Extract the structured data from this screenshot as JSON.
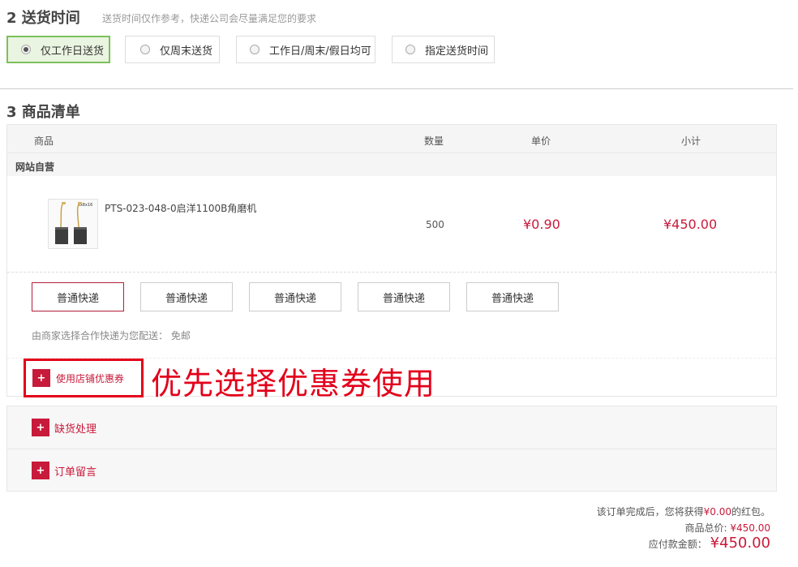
{
  "delivery": {
    "title": "2 送货时间",
    "hint": "送货时间仅作参考，快递公司会尽量满足您的要求",
    "options": [
      "仅工作日送货",
      "仅周末送货",
      "工作日/周末/假日均可",
      "指定送货时间"
    ],
    "selected_index": 0
  },
  "goods": {
    "title": "3 商品清单",
    "columns": {
      "product": "商品",
      "qty": "数量",
      "price": "单价",
      "subtotal": "小计"
    },
    "shop_name": "网站自营",
    "item": {
      "name": "PTS-023-048-0启洋1100B角磨机",
      "qty": "500",
      "price": "¥0.90",
      "subtotal": "¥450.00",
      "image_label": "5x8x16"
    },
    "shipping_options": [
      "普通快递",
      "普通快递",
      "普通快递",
      "普通快递",
      "普通快递"
    ],
    "shipping_selected_index": 0,
    "shipping_note": "由商家选择合作快递为您配送： 免邮",
    "coupon_label": "使用店铺优惠券",
    "annotation": "优先选择优惠券使用"
  },
  "extras": {
    "stockout_label": "缺货处理",
    "message_label": "订单留言"
  },
  "summary": {
    "redpacket_prefix": "该订单完成后，您将获得",
    "redpacket_amount": "¥0.00",
    "redpacket_suffix": "的红包。",
    "goods_total_label": "商品总价:",
    "goods_total": "¥450.00",
    "pay_label": "应付款金额：",
    "pay_amount": "¥450.00"
  },
  "colors": {
    "accent": "#c81a3a",
    "selected_green": "#7cc05a",
    "annotation_red": "#e3001b"
  },
  "icons": {
    "add": "plus-icon",
    "radio": "radio-icon"
  }
}
